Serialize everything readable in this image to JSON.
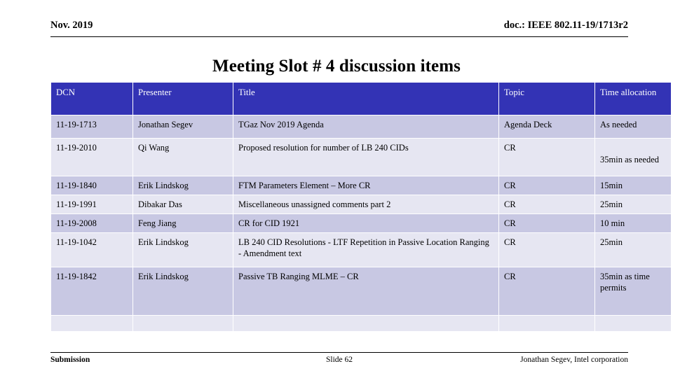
{
  "header": {
    "date": "Nov. 2019",
    "doc_number": "doc.: IEEE 802.11-19/1713r2"
  },
  "title": "Meeting Slot # 4 discussion items",
  "table": {
    "columns": [
      "DCN",
      "Presenter",
      "Title",
      "Topic",
      "Time allocation"
    ],
    "header_bg": "#3333B5",
    "header_fg": "#FFFFFF",
    "row_shade_dark": "#C8C8E3",
    "row_shade_light": "#E6E6F2",
    "rows": [
      {
        "dcn": "11-19-1713",
        "presenter": "Jonathan Segev",
        "title": "TGaz Nov 2019 Agenda",
        "topic": "Agenda Deck",
        "time": "As needed"
      },
      {
        "dcn": "11-19-2010",
        "presenter": "Qi Wang",
        "title": "Proposed resolution for number of LB 240 CIDs",
        "topic": "CR",
        "time": "35min as needed"
      },
      {
        "dcn": "11-19-1840",
        "presenter": "Erik Lindskog",
        "title": "FTM Parameters Element – More CR",
        "topic": "CR",
        "time": "15min"
      },
      {
        "dcn": "11-19-1991",
        "presenter": "Dibakar Das",
        "title": "Miscellaneous unassigned comments part 2",
        "topic": "CR",
        "time": "25min"
      },
      {
        "dcn": "11-19-2008",
        "presenter": "Feng Jiang",
        "title": "CR for CID 1921",
        "topic": "CR",
        "time": "10 min"
      },
      {
        "dcn": "11-19-1042",
        "presenter": "Erik Lindskog",
        "title": "LB 240 CID Resolutions - LTF Repetition in Passive Location Ranging - Amendment text",
        "topic": "CR",
        "time": "25min"
      },
      {
        "dcn": "11-19-1842",
        "presenter": "Erik Lindskog",
        "title": "Passive TB Ranging MLME – CR",
        "topic": "CR",
        "time": "35min as time permits"
      },
      {
        "dcn": "",
        "presenter": "",
        "title": "",
        "topic": "",
        "time": ""
      }
    ]
  },
  "footer": {
    "left": "Submission",
    "center": "Slide 62",
    "right": "Jonathan Segev, Intel corporation"
  }
}
